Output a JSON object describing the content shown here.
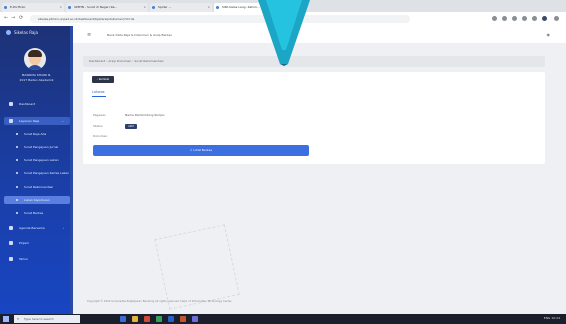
{
  "browser": {
    "tabs": [
      {
        "label": "E-Portfolio",
        "active": false
      },
      {
        "label": "SPPHN - Surat di Negeri Ra...",
        "active": false
      },
      {
        "label": "Spider ...",
        "active": false
      },
      {
        "label": "SIPA Kelas Lang- Kahim...",
        "active": true
      }
    ],
    "url": "sikelas.ptmkn.unpad.ac.id/dashboard/bpk/arsipdokumen/?id=ds"
  },
  "sidebar": {
    "brand": "Sikelas Raja",
    "user_name_line1": "MASRIMA KHAIRI N.",
    "user_name_line2": "2017 Badan Akademik",
    "items": [
      {
        "label": "Dashboard",
        "type": "main"
      },
      {
        "label": "Layanan Raja",
        "type": "open",
        "chevron": "⌄"
      },
      {
        "label": "Surat Raja Ada",
        "type": "sub"
      },
      {
        "label": "Surat Pengajuan Jurnal",
        "type": "sub"
      },
      {
        "label": "Surat Pengajuan Lakan",
        "type": "sub"
      },
      {
        "label": "Surat Pengajuan Kertas Lakan",
        "type": "sub"
      },
      {
        "label": "Surat Rekomendasi",
        "type": "sub"
      },
      {
        "label": "Lakan Keputusan",
        "type": "active"
      },
      {
        "label": "Surat Berkas",
        "type": "sub"
      },
      {
        "label": "Agenda Bersama",
        "type": "main",
        "chevron": "›"
      },
      {
        "label": "Pinjam",
        "type": "main"
      },
      {
        "label": "Tahun",
        "type": "main"
      }
    ]
  },
  "header": {
    "title": "Bank Data Raja & Dokumen & Arsip Berkas"
  },
  "breadcrumb": "Dashboard  ›  Arsip Dokumen  ›  Surat Rekomendasi",
  "card": {
    "back_label": "‹ Kembali",
    "title": "Lakwas",
    "fields": [
      {
        "label": "Pegawai",
        "value": "Nama Pembimbing Skripsi"
      },
      {
        "label": "Status",
        "value": "Aktif"
      },
      {
        "label": "Dokumen",
        "value": ""
      }
    ],
    "primary_label": "⇩  Lihat Berkas"
  },
  "footer": "Copyright © 2022 Universitas Padjadjaran Bandung All rights reserved. Dept. of Information Technology Center",
  "taskbar": {
    "search_placeholder": "Type here to search",
    "time": "ENG  10:24"
  },
  "icons": {
    "hamburger": "≡",
    "bell": "🔔",
    "back_arrow": "←",
    "forward_arrow": "→",
    "reload": "⟳"
  }
}
